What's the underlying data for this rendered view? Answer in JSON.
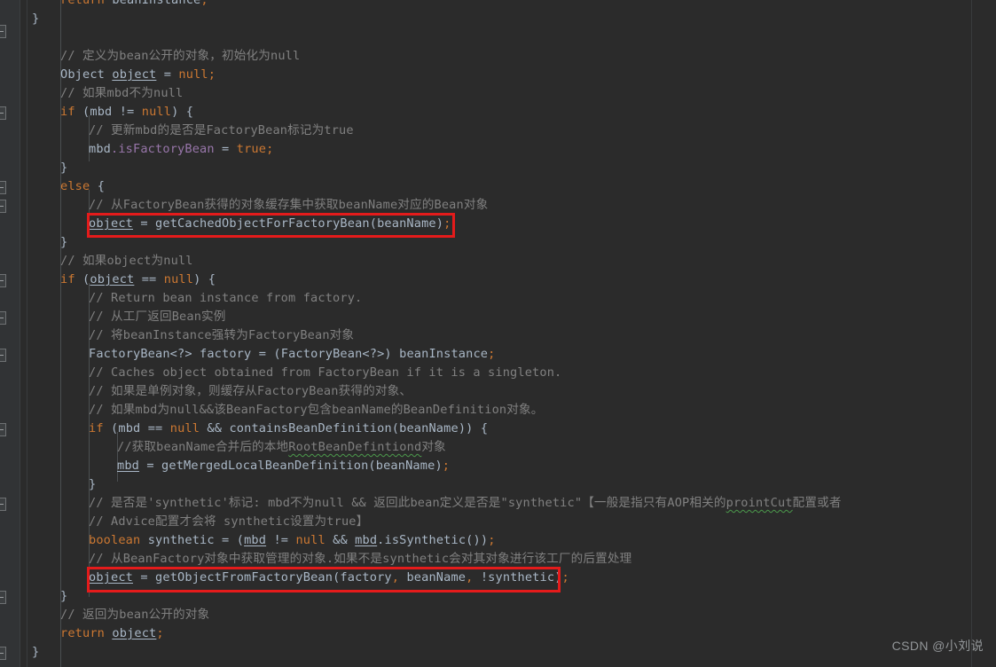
{
  "editor": {
    "theme": "darcula",
    "background_color": "#2b2b2b",
    "gutter_color": "#313335",
    "default_text_color": "#a9b7c6",
    "comment_color": "#808080",
    "keyword_color": "#cc7832",
    "field_color": "#9876aa",
    "annotation_box_color": "#e41b1b",
    "spellcheck_squiggle_color": "#4c9a4c"
  },
  "watermark": {
    "text": "CSDN @小刘说"
  },
  "code_lines": [
    {
      "indent": 2,
      "text": "return beanInstance;"
    },
    {
      "indent": 1,
      "text": "}"
    },
    {
      "indent": 0,
      "text": ""
    },
    {
      "indent": 1,
      "text": "// 定义为bean公开的对象，初始化为null"
    },
    {
      "indent": 1,
      "text": "Object object = null;"
    },
    {
      "indent": 1,
      "text": "// 如果mbd不为null"
    },
    {
      "indent": 1,
      "text": "if (mbd != null) {"
    },
    {
      "indent": 2,
      "text": "// 更新mbd的是否是FactoryBean标记为true"
    },
    {
      "indent": 2,
      "text": "mbd.isFactoryBean = true;"
    },
    {
      "indent": 1,
      "text": "}"
    },
    {
      "indent": 1,
      "text": "else {"
    },
    {
      "indent": 2,
      "text": "// 从FactoryBean获得的对象缓存集中获取beanName对应的Bean对象"
    },
    {
      "indent": 2,
      "text": "object = getCachedObjectForFactoryBean(beanName);"
    },
    {
      "indent": 1,
      "text": "}"
    },
    {
      "indent": 1,
      "text": "// 如果object为null"
    },
    {
      "indent": 1,
      "text": "if (object == null) {"
    },
    {
      "indent": 2,
      "text": "// Return bean instance from factory."
    },
    {
      "indent": 2,
      "text": "// 从工厂返回Bean实例"
    },
    {
      "indent": 2,
      "text": "// 将beanInstance强转为FactoryBean对象"
    },
    {
      "indent": 2,
      "text": "FactoryBean<?> factory = (FactoryBean<?>) beanInstance;"
    },
    {
      "indent": 2,
      "text": "// Caches object obtained from FactoryBean if it is a singleton."
    },
    {
      "indent": 2,
      "text": "// 如果是单例对象，则缓存从FactoryBean获得的对象、"
    },
    {
      "indent": 2,
      "text": "// 如果mbd为null&&该BeanFactory包含beanName的BeanDefinition对象。"
    },
    {
      "indent": 2,
      "text": "if (mbd == null && containsBeanDefinition(beanName)) {"
    },
    {
      "indent": 3,
      "text": "//获取beanName合并后的本地RootBeanDefintiond对象"
    },
    {
      "indent": 3,
      "text": "mbd = getMergedLocalBeanDefinition(beanName);"
    },
    {
      "indent": 2,
      "text": "}"
    },
    {
      "indent": 2,
      "text": "// 是否是'synthetic'标记: mbd不为null && 返回此bean定义是否是\"synthetic\"【一般是指只有AOP相关的prointCut配置或者"
    },
    {
      "indent": 2,
      "text": "// Advice配置才会将 synthetic设置为true】"
    },
    {
      "indent": 2,
      "text": "boolean synthetic = (mbd != null && mbd.isSynthetic());"
    },
    {
      "indent": 2,
      "text": "// 从BeanFactory对象中获取管理的对象.如果不是synthetic会对其对象进行该工厂的后置处理"
    },
    {
      "indent": 2,
      "text": "object = getObjectFromFactoryBean(factory, beanName, !synthetic);"
    },
    {
      "indent": 1,
      "text": "}"
    },
    {
      "indent": 1,
      "text": "// 返回为bean公开的对象"
    },
    {
      "indent": 1,
      "text": "return object;"
    },
    {
      "indent": 0,
      "text": "}"
    }
  ],
  "annotations": [
    {
      "label": "highlight-box-get-cached-object",
      "target_text": "object = getCachedObjectForFactoryBean(beanName);"
    },
    {
      "label": "highlight-box-get-object-from-factory-bean",
      "target_text": "object = getObjectFromFactoryBean(factory, beanName, !synthetic);"
    }
  ],
  "spellcheck_typos": [
    "RootBeanDefintiond",
    "prointCut"
  ]
}
